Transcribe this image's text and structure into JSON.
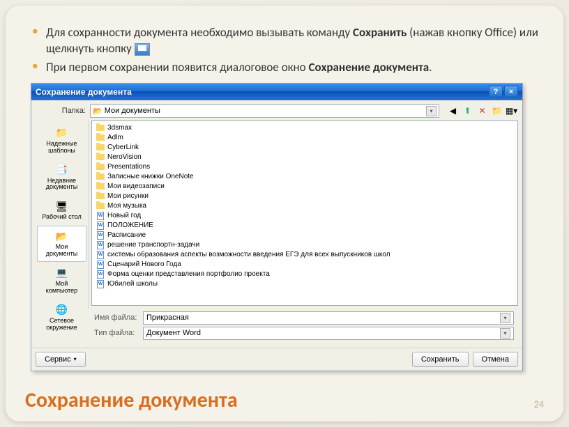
{
  "slide": {
    "bullet1_a": "Для сохранности документа необходимо вызывать команду ",
    "bullet1_b": "Сохранить",
    "bullet1_c": " (нажав кнопку Office) или щелкнуть кнопку ",
    "bullet2_a": "При первом сохранении появится диалоговое окно ",
    "bullet2_b": "Сохранение документа",
    "bullet2_c": ".",
    "title": "Сохранение документа",
    "page": "24"
  },
  "dialog": {
    "title": "Сохранение документа",
    "folder_label": "Папка:",
    "folder_value": "Мои документы",
    "filename_label": "Имя файла:",
    "filename_value": "Прикрасная",
    "filetype_label": "Тип файла:",
    "filetype_value": "Документ Word",
    "service_btn": "Сервис",
    "save_btn": "Сохранить",
    "cancel_btn": "Отмена",
    "places": [
      {
        "label": "Надежные шаблоны",
        "icon": "📁"
      },
      {
        "label": "Недавние документы",
        "icon": "📑"
      },
      {
        "label": "Рабочий стол",
        "icon": "🖥"
      },
      {
        "label": "Мои документы",
        "icon": "📂",
        "selected": true
      },
      {
        "label": "Мой компьютер",
        "icon": "💻"
      },
      {
        "label": "Сетевое окружение",
        "icon": "🌐"
      }
    ],
    "files": [
      {
        "name": "3dsmax",
        "type": "folder"
      },
      {
        "name": "Adlm",
        "type": "folder"
      },
      {
        "name": "CyberLink",
        "type": "folder"
      },
      {
        "name": "NeroVision",
        "type": "folder"
      },
      {
        "name": "Presentations",
        "type": "folder"
      },
      {
        "name": "Записные книжки OneNote",
        "type": "folder"
      },
      {
        "name": "Мои видеозаписи",
        "type": "folder"
      },
      {
        "name": "Мои рисунки",
        "type": "folder"
      },
      {
        "name": "Моя музыка",
        "type": "folder"
      },
      {
        "name": "Новый год",
        "type": "doc"
      },
      {
        "name": "ПОЛОЖЕНИЕ",
        "type": "doc"
      },
      {
        "name": "Расписание",
        "type": "doc"
      },
      {
        "name": "решение транспортн-задачи",
        "type": "doc"
      },
      {
        "name": "системы образования аспекты возможности введения ЕГЭ для всех выпускников школ",
        "type": "doc"
      },
      {
        "name": "Сценарий Нового Года",
        "type": "doc"
      },
      {
        "name": "Форма оценки представления портфолио проекта",
        "type": "doc"
      },
      {
        "name": "Юбилей школы",
        "type": "doc"
      }
    ]
  }
}
